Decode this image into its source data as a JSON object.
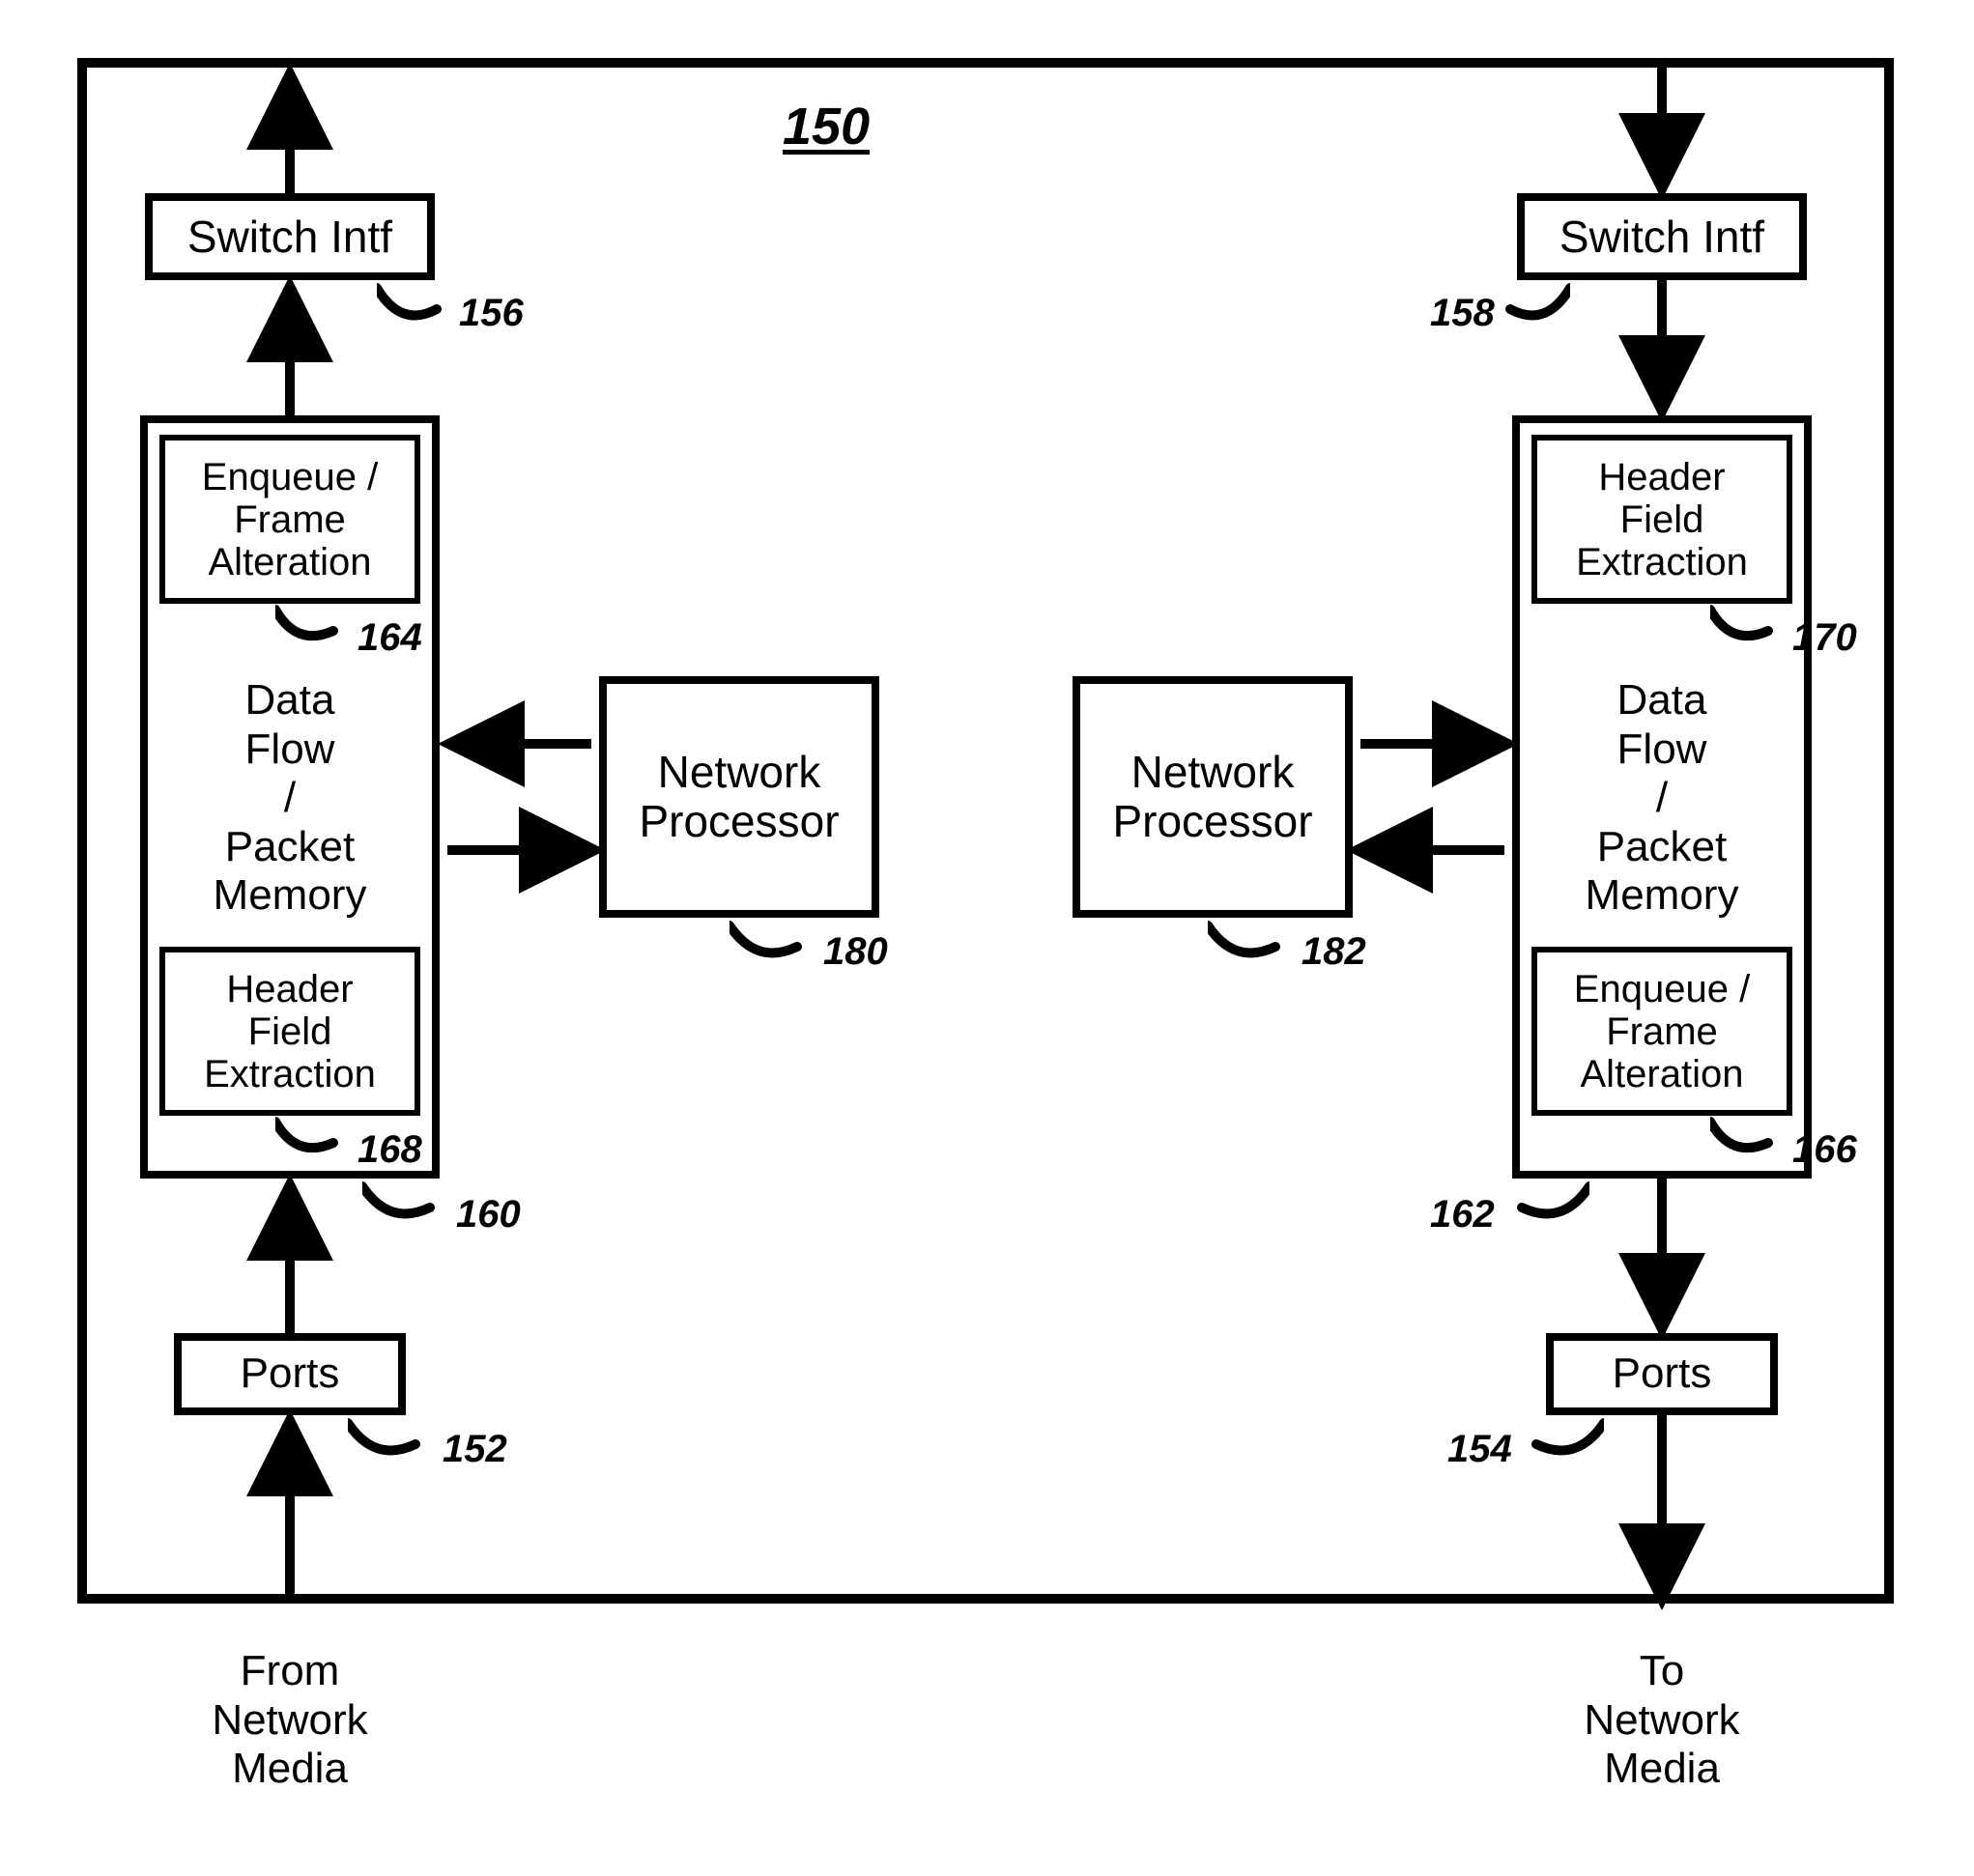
{
  "title_ref": "150",
  "left": {
    "switch_intf": "Switch Intf",
    "switch_intf_ref": "156",
    "dataflow_body": "Data\nFlow\n/\nPacket\nMemory",
    "dataflow_ref": "160",
    "top_sub": "Enqueue /\nFrame\nAlteration",
    "top_sub_ref": "164",
    "bot_sub": "Header\nField\nExtraction",
    "bot_sub_ref": "168",
    "ports": "Ports",
    "ports_ref": "152",
    "np": "Network\nProcessor",
    "np_ref": "180",
    "media": "From\nNetwork\nMedia"
  },
  "right": {
    "switch_intf": "Switch Intf",
    "switch_intf_ref": "158",
    "dataflow_body": "Data\nFlow\n/\nPacket\nMemory",
    "dataflow_ref": "162",
    "top_sub": "Header\nField\nExtraction",
    "top_sub_ref": "170",
    "bot_sub": "Enqueue /\nFrame\nAlteration",
    "bot_sub_ref": "166",
    "ports": "Ports",
    "ports_ref": "154",
    "np": "Network\nProcessor",
    "np_ref": "182",
    "media": "To\nNetwork\nMedia"
  }
}
